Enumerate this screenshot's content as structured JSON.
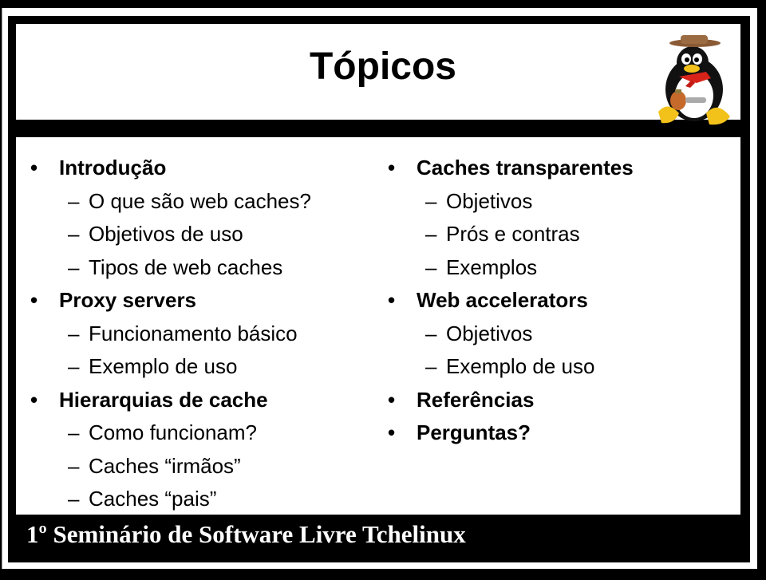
{
  "slide": {
    "title": "Tópicos",
    "footer": "1º Seminário de Software Livre Tchelinux",
    "logo_icon": "tux-gaucho-penguin-logo",
    "colors": {
      "background": "#000000",
      "panel": "#ffffff",
      "text": "#000000",
      "footer_text": "#ffffff"
    }
  },
  "bullet_glyph": "•",
  "dash_glyph": "–",
  "columns": [
    {
      "items": [
        {
          "level": 1,
          "text": "Introdução"
        },
        {
          "level": 2,
          "text": "O que são web caches?"
        },
        {
          "level": 2,
          "text": "Objetivos de uso"
        },
        {
          "level": 2,
          "text": "Tipos de web caches"
        },
        {
          "level": 1,
          "text": "Proxy servers"
        },
        {
          "level": 2,
          "text": "Funcionamento básico"
        },
        {
          "level": 2,
          "text": "Exemplo de uso"
        },
        {
          "level": 1,
          "text": "Hierarquias de cache"
        },
        {
          "level": 2,
          "text": "Como funcionam?"
        },
        {
          "level": 2,
          "text": "Caches “irmãos”"
        },
        {
          "level": 2,
          "text": "Caches “pais”"
        }
      ]
    },
    {
      "items": [
        {
          "level": 1,
          "text": "Caches transparentes"
        },
        {
          "level": 2,
          "text": "Objetivos"
        },
        {
          "level": 2,
          "text": "Prós e contras"
        },
        {
          "level": 2,
          "text": "Exemplos"
        },
        {
          "level": 1,
          "text": "Web accelerators"
        },
        {
          "level": 2,
          "text": "Objetivos"
        },
        {
          "level": 2,
          "text": "Exemplo de uso"
        },
        {
          "level": 1,
          "text": "Referências"
        },
        {
          "level": 1,
          "text": "Perguntas?"
        }
      ]
    }
  ]
}
